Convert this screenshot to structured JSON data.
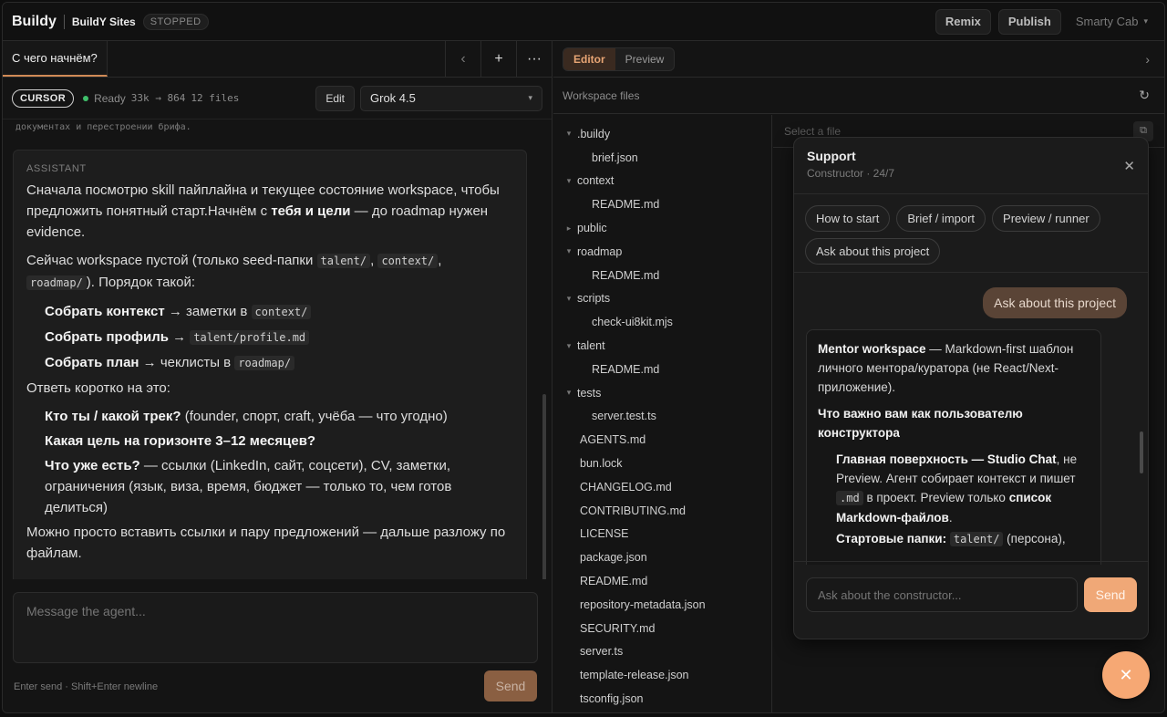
{
  "topbar": {
    "brand": "Buildy",
    "sites": "BuildY Sites",
    "status_badge": "STOPPED",
    "remix": "Remix",
    "publish": "Publish",
    "user": "Smarty Cab",
    "user_caret": "▾"
  },
  "left": {
    "tab_label": "С чего начнём?",
    "icons": {
      "back": "‹",
      "add": "+",
      "more": "···"
    },
    "status": {
      "agent": "CURSOR",
      "ready": "Ready",
      "tokens": "33k → 864",
      "files": "12 files",
      "edit": "Edit",
      "model": "Grok 4.5",
      "model_caret": "▾"
    },
    "prev_snippet": "документах и перестроении брифа.",
    "message": {
      "role": "ASSISTANT",
      "p1_a": "Сначала посмотрю skill пайплайна и текущее состояние workspace, чтобы предложить понятный старт.Начнём с ",
      "p1_b": "тебя и цели",
      "p1_c": " — до roadmap нужен evidence.",
      "p2_a": "Сейчас workspace пустой (только seed-папки ",
      "p2_code1": "talent/",
      "p2_sep": ", ",
      "p2_code2": "context/",
      "p2_sep2": ",",
      "p2_code3": "roadmap/",
      "p2_b": "). Порядок такой:",
      "s1_b": "Собрать контекст",
      "s1_t": " → заметки в ",
      "s1_c": "context/",
      "s2_b": "Собрать профиль",
      "s2_t": " → ",
      "s2_c": "talent/profile.md",
      "s3_b": "Собрать план",
      "s3_t": " → чеклисты в ",
      "s3_c": "roadmap/",
      "ask": "Ответь коротко на это:",
      "q1_b": "Кто ты / какой трек?",
      "q1_t": " (founder, спорт, craft, учёба — что угодно)",
      "q2_b": "Какая цель на горизонте 3–12 месяцев?",
      "q3_b": "Что уже есть?",
      "q3_t": " — ссылки (LinkedIn, сайт, соцсети), CV, заметки, ограничения (язык, виза, время, бюджет — только то, чем готов делиться)",
      "final": "Можно просто вставить ссылки и пару предложений — дальше разложу по файлам."
    },
    "composer_placeholder": "Message the agent...",
    "hint": "Enter send · Shift+Enter newline",
    "send": "Send"
  },
  "right": {
    "tabs": [
      "Editor",
      "Preview"
    ],
    "chevron": "›",
    "workspace_title": "Workspace files",
    "refresh": "↻",
    "file_placeholder": "Select a file",
    "tree": [
      {
        "label": ".buildy",
        "kind": "folder",
        "arrow": "▾"
      },
      {
        "label": "brief.json",
        "kind": "child"
      },
      {
        "label": "context",
        "kind": "folder",
        "arrow": "▾"
      },
      {
        "label": "README.md",
        "kind": "child"
      },
      {
        "label": "public",
        "kind": "folder",
        "arrow": "▸"
      },
      {
        "label": "roadmap",
        "kind": "folder",
        "arrow": "▾"
      },
      {
        "label": "README.md",
        "kind": "child"
      },
      {
        "label": "scripts",
        "kind": "folder",
        "arrow": "▾"
      },
      {
        "label": "check-ui8kit.mjs",
        "kind": "child"
      },
      {
        "label": "talent",
        "kind": "folder",
        "arrow": "▾"
      },
      {
        "label": "README.md",
        "kind": "child"
      },
      {
        "label": "tests",
        "kind": "folder",
        "arrow": "▾"
      },
      {
        "label": "server.test.ts",
        "kind": "child"
      },
      {
        "label": "AGENTS.md",
        "kind": "file"
      },
      {
        "label": "bun.lock",
        "kind": "file"
      },
      {
        "label": "CHANGELOG.md",
        "kind": "file"
      },
      {
        "label": "CONTRIBUTING.md",
        "kind": "file"
      },
      {
        "label": "LICENSE",
        "kind": "file"
      },
      {
        "label": "package.json",
        "kind": "file"
      },
      {
        "label": "README.md",
        "kind": "file"
      },
      {
        "label": "repository-metadata.json",
        "kind": "file"
      },
      {
        "label": "SECURITY.md",
        "kind": "file"
      },
      {
        "label": "server.ts",
        "kind": "file"
      },
      {
        "label": "template-release.json",
        "kind": "file"
      },
      {
        "label": "tsconfig.json",
        "kind": "file"
      }
    ]
  },
  "support": {
    "title": "Support",
    "subtitle": "Constructor · 24/7",
    "close": "✕",
    "chips": [
      "How to start",
      "Brief / import",
      "Preview / runner",
      "Ask about this project"
    ],
    "user_msg": "Ask about this project",
    "bot": {
      "p1_b": "Mentor workspace",
      "p1_t": " — Markdown-first шаблон личного ментора/куратора (не React/Next-приложение).",
      "h": "Что важно вам как пользователю конструктора",
      "i1_b": "Главная поверхность — Studio Chat",
      "i1_t": ", не Preview. Агент собирает контекст и пишет ",
      "i1_c": ".md",
      "i1_t2": " в проект. Preview только ",
      "i1_b2": "список Markdown-файлов",
      "i1_end": ".",
      "i2_b": "Стартовые папки:",
      "i2_c": "talent/",
      "i2_t": " (персона),"
    },
    "input_placeholder": "Ask about the constructor...",
    "send": "Send"
  },
  "fab": "✕"
}
